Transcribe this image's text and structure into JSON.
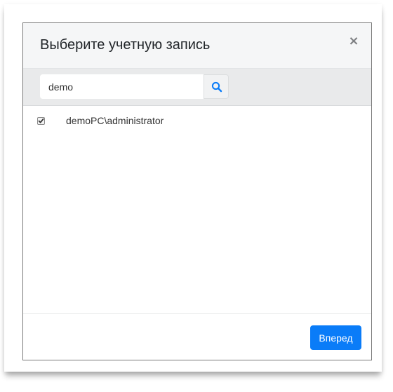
{
  "dialog": {
    "title": "Выберите учетную запись",
    "close_label": "×"
  },
  "search": {
    "value": "demo",
    "icon": "search-icon",
    "accent_color": "#0a7cf8"
  },
  "accounts": [
    {
      "label": "demoPC\\administrator",
      "checked": true
    }
  ],
  "footer": {
    "next_label": "Вперед",
    "button_color": "#0a7cf8"
  }
}
